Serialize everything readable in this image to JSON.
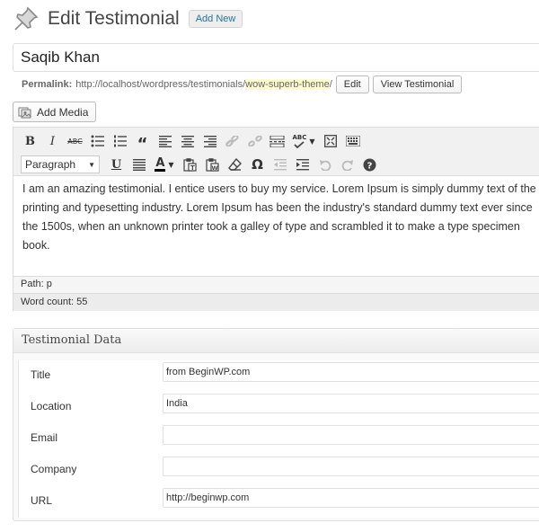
{
  "header": {
    "title": "Edit Testimonial",
    "add_new_label": "Add New",
    "icon": "pushpin-icon"
  },
  "post": {
    "title_value": "Saqib Khan"
  },
  "permalink": {
    "label": "Permalink:",
    "base_url": "http://localhost/wordpress/testimonials/",
    "slug": "wow-superb-theme",
    "trailing": "/",
    "edit_label": "Edit",
    "view_label": "View Testimonial"
  },
  "media": {
    "add_media_label": "Add Media",
    "icon": "media-icon"
  },
  "toolbar": {
    "row1": [
      "bold",
      "italic",
      "strikethrough",
      "bulleted-list",
      "numbered-list",
      "blockquote",
      "align-left",
      "align-center",
      "align-right",
      "insert-link",
      "remove-link",
      "insert-more",
      "spellcheck",
      "fullscreen",
      "kitchen-sink"
    ],
    "row2": [
      "format-select",
      "underline",
      "justify",
      "text-color",
      "paste-text",
      "paste-word",
      "clear-formatting",
      "special-character",
      "outdent",
      "indent",
      "undo",
      "redo",
      "help"
    ],
    "format_value": "Paragraph",
    "bold_glyph": "B",
    "italic_glyph": "I",
    "strike_glyph": "ABC",
    "quote_glyph": "“",
    "underline_glyph": "U",
    "omega_glyph": "Ω",
    "spell_glyph": "ABC"
  },
  "content": {
    "text": "I am an amazing testimonial. I entice users to buy my service. Lorem Ipsum is simply dummy text of the printing and typesetting industry. Lorem Ipsum has been the industry's standard dummy text ever since the 1500s, when an unknown printer took a galley of type and scrambled it to make a type specimen book."
  },
  "status": {
    "path_label": "Path:",
    "path_value": "p",
    "word_count_label": "Word count:",
    "word_count_value": "55"
  },
  "meta_box": {
    "title": "Testimonial Data",
    "fields": [
      {
        "label": "Title",
        "value": ""
      },
      {
        "label": "Location",
        "value": "India"
      },
      {
        "label": "Email",
        "value": ""
      },
      {
        "label": "Company",
        "value": ""
      },
      {
        "label": "URL",
        "value": "http://beginwp.com"
      }
    ],
    "title_field_value": "from BeginWP.com"
  },
  "colors": {
    "link": "#21759b",
    "slug_highlight": "#fffbcc",
    "toolbar_bg": "#f1f1f1"
  }
}
